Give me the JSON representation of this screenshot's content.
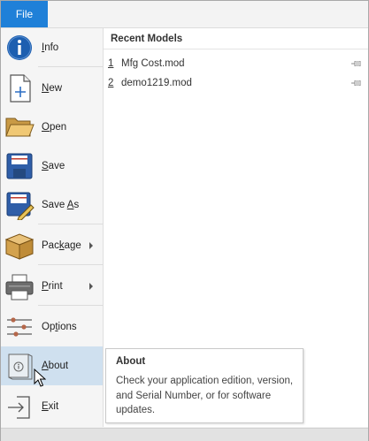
{
  "file_tab": "File",
  "menu": [
    {
      "key": "info",
      "icon": "info-icon",
      "pre": "",
      "acc": "I",
      "post": "nfo",
      "arrow": false
    },
    {
      "key": "new",
      "icon": "new-document-icon",
      "pre": "",
      "acc": "N",
      "post": "ew",
      "arrow": false
    },
    {
      "key": "open",
      "icon": "folder-open-icon",
      "pre": "",
      "acc": "O",
      "post": "pen",
      "arrow": false
    },
    {
      "key": "save",
      "icon": "floppy-disk-icon",
      "pre": "",
      "acc": "S",
      "post": "ave",
      "arrow": false
    },
    {
      "key": "save-as",
      "icon": "save-as-icon",
      "pre": "Save ",
      "acc": "A",
      "post": "s",
      "arrow": false
    },
    {
      "key": "package",
      "icon": "package-box-icon",
      "pre": "Pac",
      "acc": "k",
      "post": "age",
      "arrow": true
    },
    {
      "key": "print",
      "icon": "printer-icon",
      "pre": "",
      "acc": "P",
      "post": "rint",
      "arrow": true
    },
    {
      "key": "options",
      "icon": "sliders-icon",
      "pre": "Op",
      "acc": "t",
      "post": "ions",
      "arrow": false
    },
    {
      "key": "about",
      "icon": "about-icon",
      "pre": "",
      "acc": "A",
      "post": "bout",
      "arrow": false
    },
    {
      "key": "exit",
      "icon": "exit-icon",
      "pre": "",
      "acc": "E",
      "post": "xit",
      "arrow": false
    }
  ],
  "recent": {
    "title": "Recent Models",
    "items": [
      {
        "num": "1",
        "name": "Mfg Cost.mod"
      },
      {
        "num": "2",
        "name": "demo1219.mod"
      }
    ]
  },
  "tooltip": {
    "title": "About",
    "body": "Check your application edition, version, and Serial Number, or for software updates."
  },
  "colors": {
    "file_tab": "#1f80d8",
    "hover": "#cfe0ef",
    "info_blue": "#1d5fb0"
  }
}
